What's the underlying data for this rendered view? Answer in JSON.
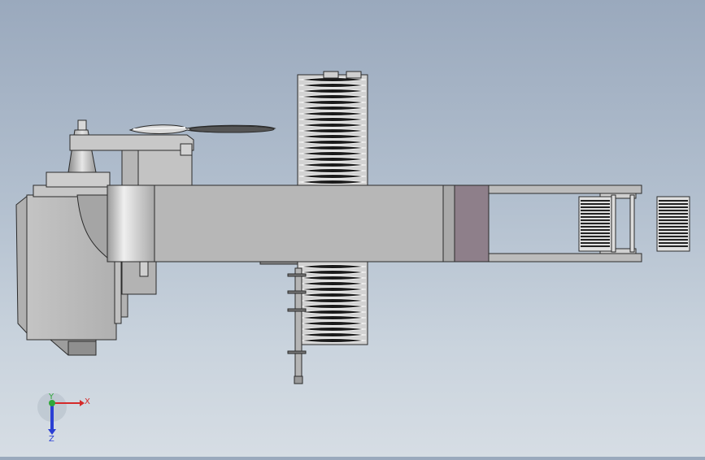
{
  "triad": {
    "x_label": "X",
    "y_label": "Y",
    "z_label": "Z",
    "x_color": "#d42a2a",
    "y_color": "#2fa83a",
    "z_color": "#2a3fd4"
  },
  "model": {
    "body_color": "#b9b9b9",
    "shade_color": "#8f8f8f",
    "dark_panel_color": "#8e7f8a",
    "edge_color": "#2b2b2b",
    "spring_color": "#1a1a1a"
  }
}
